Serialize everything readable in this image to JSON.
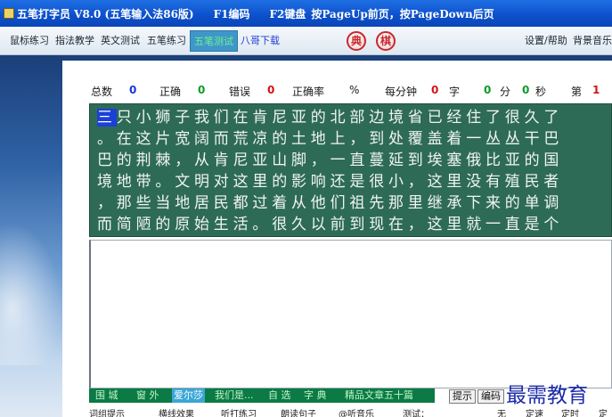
{
  "titlebar": {
    "app_name": "五笔打字员 V8.0 (五笔输入法86版)",
    "hint_f1": "F1编码",
    "hint_f2": "F2键盘",
    "hint_page": "按PageUp前页，按PageDown后页"
  },
  "menubar": {
    "tabs": [
      "鼠标练习",
      "指法教学",
      "英文测试",
      "五笔练习",
      "五笔测试",
      "八哥下载"
    ],
    "active_tab": "五笔测试",
    "seal_dict": "典",
    "seal_game": "棋",
    "settings_help": "设置/帮助",
    "bg_music": "背景音乐"
  },
  "stats": {
    "total_label": "总数",
    "total_value": "0",
    "correct_label": "正确",
    "correct_value": "0",
    "wrong_label": "错误",
    "wrong_value": "0",
    "accuracy_label": "正确率",
    "accuracy_unit": "%",
    "per_min_label": "每分钟",
    "per_min_value": "0",
    "per_min_unit": "字",
    "time_min_value": "0",
    "time_min_unit": "分",
    "time_sec_value": "0",
    "time_sec_unit": "秒",
    "page_label": "第",
    "page_value": "1"
  },
  "practice_text": {
    "current_char": "三",
    "line1_rest": "只小狮子我们在肯尼亚的北部边境省已经住了很久了",
    "line2": "。在这片宽阔而荒凉的土地上，到处覆盖着一丛丛干巴",
    "line3": "巴的荆棘，从肯尼亚山脚，一直蔓延到埃塞俄比亚的国",
    "line4": "境地带。文明对这里的影响还是很小，这里没有殖民者",
    "line5": "，那些当地居民都过着从他们祖先那里继承下来的单调",
    "line6": "而简陋的原始生活。很久以前到现在，这里就一直是个"
  },
  "bottom_tabs": [
    "围 城",
    "窗 外",
    "爱尔莎",
    "我们是...",
    "自 选",
    "字 典",
    "精品文章五十篇"
  ],
  "bottom_tabs_highlighted": "爱尔莎",
  "buttons": {
    "hint": "提示",
    "encoding": "编码"
  },
  "options_strip": [
    "词组提示",
    "横线效果",
    "听打练习",
    "朗读句子",
    "@听音乐",
    "测试：",
    "无",
    "定速",
    "定时",
    "定"
  ],
  "watermark": "最需教育",
  "colors": {
    "text_bg": "#2e6b57",
    "title_bg": "#0c4fcb",
    "active_tab_bg": "#3f97c9"
  }
}
